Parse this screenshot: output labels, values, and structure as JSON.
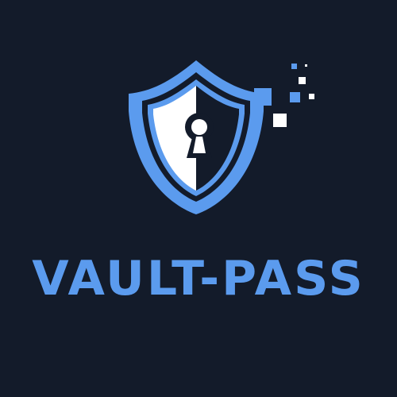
{
  "logo": {
    "name": "VAULT-PASS",
    "icon": "shield-keyhole-icon"
  },
  "colors": {
    "background": "#131b2a",
    "accent": "#5b9bee",
    "shield_light_half": "#ffffff",
    "keyhole": "#131b2a"
  }
}
